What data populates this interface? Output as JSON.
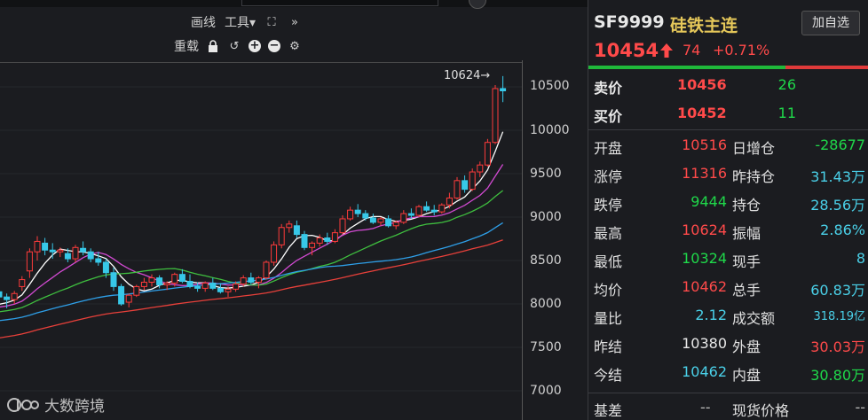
{
  "toolbar": {
    "draw_line": "画线",
    "tools": "工具",
    "tools_caret": "▾",
    "fullscreen_icon": "⛶",
    "collapse_icon": "»",
    "reset": "重载",
    "lock_icon": "🔒",
    "undo_icon": "↺",
    "zoom_in": "+",
    "zoom_out": "−",
    "settings_icon": "⚙"
  },
  "chart": {
    "y_axis": [
      "10500",
      "10000",
      "9500",
      "9000",
      "8500",
      "8000",
      "7500",
      "7000"
    ],
    "max_label": "10624→",
    "watermark": "大数跨境"
  },
  "chart_data": {
    "type": "candlestick",
    "ylim": [
      6950,
      10750
    ],
    "ohlc": [
      [
        8140,
        8260,
        8020,
        8080
      ],
      [
        8080,
        8120,
        7950,
        8050
      ],
      [
        8050,
        8150,
        8000,
        8120
      ],
      [
        8200,
        8320,
        8150,
        8280
      ],
      [
        8380,
        8640,
        8300,
        8600
      ],
      [
        8600,
        8780,
        8500,
        8720
      ],
      [
        8700,
        8760,
        8560,
        8620
      ],
      [
        8620,
        8700,
        8520,
        8600
      ],
      [
        8600,
        8650,
        8540,
        8620
      ],
      [
        8580,
        8640,
        8480,
        8520
      ],
      [
        8520,
        8680,
        8480,
        8650
      ],
      [
        8640,
        8720,
        8560,
        8600
      ],
      [
        8600,
        8640,
        8480,
        8520
      ],
      [
        8520,
        8600,
        8440,
        8480
      ],
      [
        8480,
        8520,
        8300,
        8360
      ],
      [
        8360,
        8420,
        8150,
        8200
      ],
      [
        8200,
        8230,
        7980,
        8000
      ],
      [
        8020,
        8120,
        7960,
        8100
      ],
      [
        8100,
        8220,
        8080,
        8200
      ],
      [
        8200,
        8300,
        8160,
        8250
      ],
      [
        8250,
        8340,
        8200,
        8300
      ],
      [
        8300,
        8330,
        8180,
        8220
      ],
      [
        8220,
        8260,
        8160,
        8240
      ],
      [
        8240,
        8360,
        8200,
        8340
      ],
      [
        8340,
        8400,
        8240,
        8260
      ],
      [
        8260,
        8340,
        8180,
        8200
      ],
      [
        8200,
        8250,
        8140,
        8180
      ],
      [
        8180,
        8260,
        8140,
        8240
      ],
      [
        8240,
        8300,
        8160,
        8180
      ],
      [
        8180,
        8240,
        8120,
        8140
      ],
      [
        8140,
        8200,
        8080,
        8170
      ],
      [
        8170,
        8260,
        8140,
        8230
      ],
      [
        8230,
        8330,
        8200,
        8300
      ],
      [
        8300,
        8360,
        8220,
        8250
      ],
      [
        8250,
        8320,
        8180,
        8300
      ],
      [
        8300,
        8500,
        8280,
        8480
      ],
      [
        8480,
        8720,
        8440,
        8680
      ],
      [
        8680,
        8920,
        8640,
        8880
      ],
      [
        8880,
        8960,
        8820,
        8920
      ],
      [
        8900,
        8960,
        8760,
        8800
      ],
      [
        8800,
        8840,
        8620,
        8650
      ],
      [
        8650,
        8720,
        8560,
        8700
      ],
      [
        8700,
        8800,
        8660,
        8760
      ],
      [
        8760,
        8820,
        8680,
        8720
      ],
      [
        8720,
        8860,
        8700,
        8820
      ],
      [
        8820,
        9020,
        8800,
        8980
      ],
      [
        8980,
        9120,
        8960,
        9080
      ],
      [
        9080,
        9150,
        9000,
        9040
      ],
      [
        9040,
        9080,
        8960,
        8990
      ],
      [
        8990,
        9040,
        8920,
        8940
      ],
      [
        8940,
        9000,
        8900,
        8980
      ],
      [
        8980,
        9020,
        8880,
        8900
      ],
      [
        8900,
        8960,
        8860,
        8940
      ],
      [
        8940,
        9080,
        8920,
        9040
      ],
      [
        9040,
        9100,
        8980,
        9020
      ],
      [
        9020,
        9140,
        9000,
        9120
      ],
      [
        9120,
        9180,
        9060,
        9080
      ],
      [
        9080,
        9140,
        9020,
        9060
      ],
      [
        9060,
        9160,
        9040,
        9140
      ],
      [
        9140,
        9280,
        9100,
        9220
      ],
      [
        9220,
        9460,
        9200,
        9420
      ],
      [
        9420,
        9480,
        9280,
        9320
      ],
      [
        9320,
        9560,
        9300,
        9520
      ],
      [
        9520,
        9640,
        9460,
        9600
      ],
      [
        9600,
        9900,
        9580,
        9860
      ],
      [
        9860,
        10520,
        9840,
        10480
      ],
      [
        10480,
        10624,
        10324,
        10454
      ]
    ],
    "ma_lines": [
      {
        "color": "#ffffff",
        "name": "MA5"
      },
      {
        "color": "#d24ad2",
        "name": "MA10"
      },
      {
        "color": "#3fbf3f",
        "name": "MA20"
      },
      {
        "color": "#2e9fe8",
        "name": "MA40"
      },
      {
        "color": "#e8403a",
        "name": "MA60"
      }
    ]
  },
  "panel": {
    "code": "SF9999",
    "name": "硅铁主连",
    "add_btn": "加自选",
    "last": "10454",
    "arrow": "🡅",
    "change": "74",
    "pct": "+0.71%",
    "ask_label": "卖价",
    "ask_price": "10456",
    "ask_vol": "26",
    "bid_label": "买价",
    "bid_price": "10452",
    "bid_vol": "11",
    "rows": [
      {
        "l": "开盘",
        "lv": "10516",
        "lc": "red",
        "r": "日增仓",
        "rv": "-28677",
        "rc": "green"
      },
      {
        "l": "涨停",
        "lv": "11316",
        "lc": "red",
        "r": "昨持仓",
        "rv": "31.43万",
        "rc": "cyan"
      },
      {
        "l": "跌停",
        "lv": "9444",
        "lc": "green",
        "r": "持仓",
        "rv": "28.56万",
        "rc": "cyan"
      },
      {
        "l": "最高",
        "lv": "10624",
        "lc": "red",
        "r": "振幅",
        "rv": "2.86%",
        "rc": "cyan"
      },
      {
        "l": "最低",
        "lv": "10324",
        "lc": "green",
        "r": "现手",
        "rv": "8",
        "rc": "cyan"
      },
      {
        "l": "均价",
        "lv": "10462",
        "lc": "red",
        "r": "总手",
        "rv": "60.83万",
        "rc": "cyan"
      },
      {
        "l": "量比",
        "lv": "2.12",
        "lc": "cyan",
        "r": "成交额",
        "rv": "318.19亿",
        "rc": "cyan small"
      },
      {
        "l": "昨结",
        "lv": "10380",
        "lc": "white",
        "r": "外盘",
        "rv": "30.03万",
        "rc": "red"
      },
      {
        "l": "今结",
        "lv": "10462",
        "lc": "cyan",
        "r": "内盘",
        "rv": "30.80万",
        "rc": "green"
      }
    ],
    "basis_label": "基差",
    "basis_val": "--",
    "spot_label": "现货价格",
    "spot_val": "--"
  }
}
